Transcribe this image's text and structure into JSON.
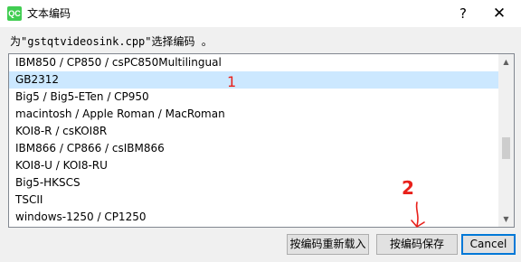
{
  "window": {
    "icon_label": "QC",
    "title": "文本编码",
    "help_label": "?",
    "close_label": "✕"
  },
  "prompt": "为\"gstqtvideosink.cpp\"选择编码 。",
  "encodings": [
    "IBM850 / CP850 / csPC850Multilingual",
    "GB2312",
    "Big5 / Big5-ETen / CP950",
    "macintosh / Apple Roman / MacRoman",
    "KOI8-R / csKOI8R",
    "IBM866 / CP866 / csIBM866",
    "KOI8-U / KOI8-RU",
    "Big5-HKSCS",
    "TSCII",
    "windows-1250 / CP1250"
  ],
  "selected_index": 1,
  "scrollbar": {
    "up_arrow": "▲",
    "down_arrow": "▼"
  },
  "annotations": {
    "one": "1",
    "two": "2",
    "arrow": "↓"
  },
  "buttons": {
    "reload": "按编码重新载入",
    "save": "按编码保存",
    "cancel": "Cancel"
  }
}
